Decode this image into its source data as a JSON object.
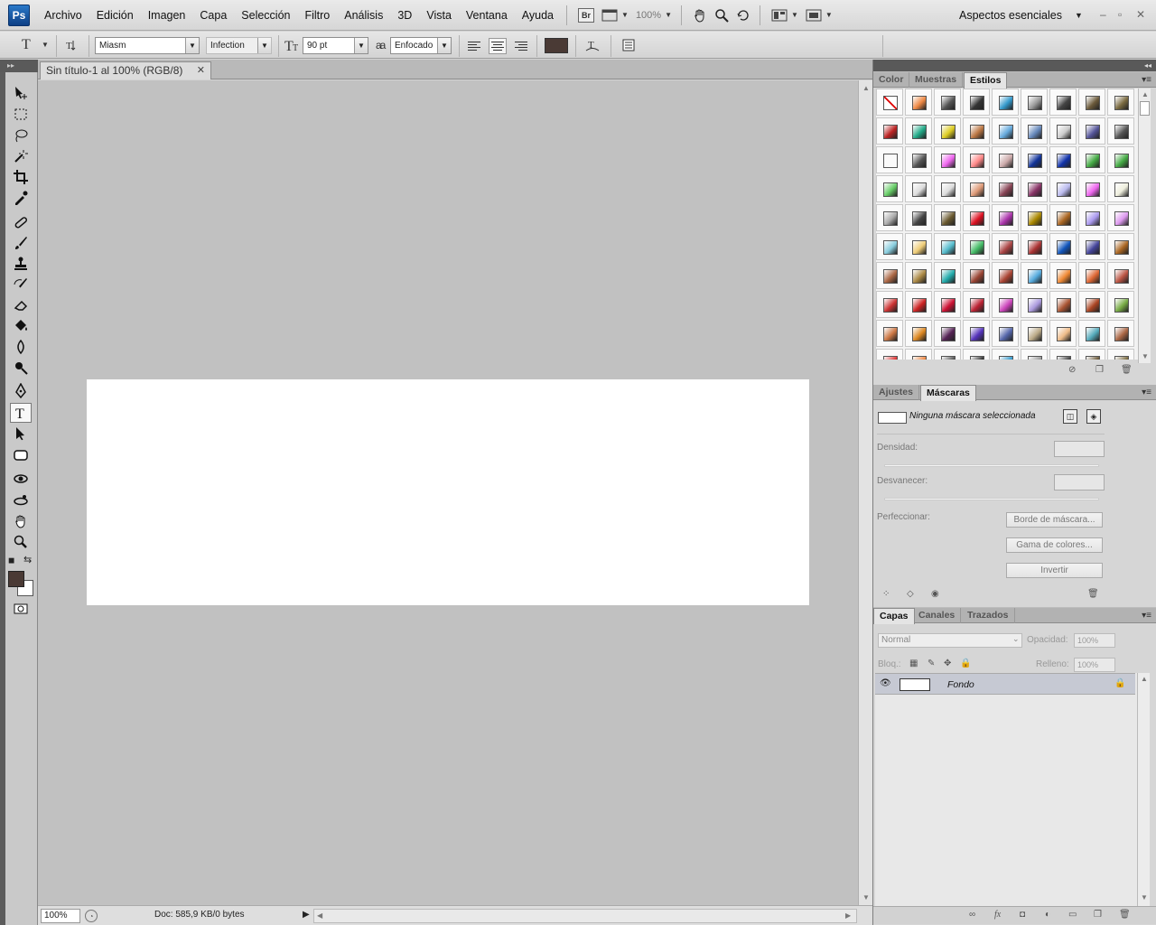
{
  "menubar": {
    "logo": "Ps",
    "items": [
      "Archivo",
      "Edición",
      "Imagen",
      "Capa",
      "Selección",
      "Filtro",
      "Análisis",
      "3D",
      "Vista",
      "Ventana",
      "Ayuda"
    ],
    "bridge_label": "Br",
    "zoom": "100%",
    "workspace": "Aspectos esenciales",
    "window_controls": [
      "–",
      "▫",
      "✕"
    ]
  },
  "options": {
    "tool_glyph": "T",
    "font_family": "Miasm",
    "font_style": "Infection",
    "font_size": "90 pt",
    "antialias_glyph": "aa",
    "antialias": "Enfocado",
    "text_color": "#4a3a35"
  },
  "document": {
    "tab_title": "Sin título-1 al 100% (RGB/8)",
    "close_glyph": "✕",
    "canvas_color": "#ffffff",
    "zoom": "100%",
    "doc_info": "Doc: 585,9 KB/0 bytes"
  },
  "toolbox": {
    "fg_color": "#4a3a35",
    "bg_color": "#ffffff"
  },
  "styles_panel": {
    "tabs": [
      "Color",
      "Muestras",
      "Estilos"
    ],
    "active_tab": "Estilos"
  },
  "masks_panel": {
    "tabs": [
      "Ajustes",
      "Máscaras"
    ],
    "active_tab": "Máscaras",
    "no_mask": "Ninguna máscara seleccionada",
    "density_label": "Densidad:",
    "feather_label": "Desvanecer:",
    "refine_label": "Perfeccionar:",
    "edge_button": "Borde de máscara...",
    "color_range_button": "Gama de colores...",
    "invert_button": "Invertir"
  },
  "layers_panel": {
    "tabs": [
      "Capas",
      "Canales",
      "Trazados"
    ],
    "active_tab": "Capas",
    "blend_mode": "Normal",
    "opacity_label": "Opacidad:",
    "opacity": "100%",
    "lock_label": "Bloq.:",
    "fill_label": "Relleno:",
    "fill": "100%",
    "layer_name": "Fondo",
    "footer_fx": "fx"
  }
}
